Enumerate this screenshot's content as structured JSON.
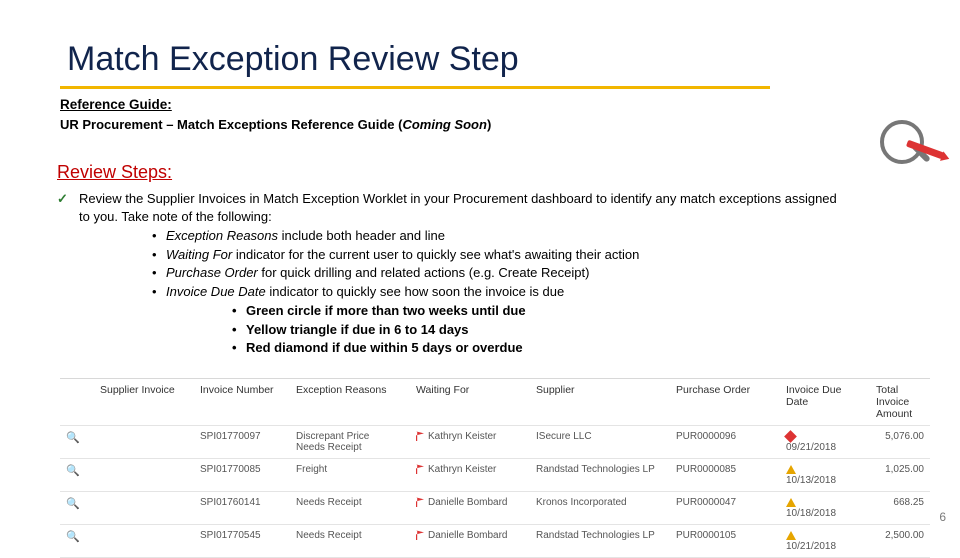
{
  "title": "Match Exception Review Step",
  "ref": {
    "label": "Reference Guide:",
    "body_a": "UR Procurement – Match Exceptions Reference Guide (",
    "coming": "Coming Soon",
    "body_b": ")"
  },
  "steps_label": "Review Steps:",
  "body": {
    "main": "Review the Supplier Invoices in Match Exception Worklet in your Procurement dashboard to identify any match exceptions assigned to you. Take note of the following:",
    "b1_lead": "Exception Reasons",
    "b1_rest": " include both header and line",
    "b2_lead": "Waiting For",
    "b2_rest": " indicator for the current user to quickly see what's awaiting their action",
    "b3_lead": "Purchase Order",
    "b3_rest": " for quick drilling and related actions (e.g. Create Receipt)",
    "b4_lead": "Invoice Due Date",
    "b4_rest": " indicator to quickly see how soon the invoice is due",
    "s1": "Green circle if more than two weeks until due",
    "s2": "Yellow triangle if due in 6 to 14 days",
    "s3": "Red diamond if due within 5 days or overdue"
  },
  "table": {
    "h": {
      "inv": "Supplier Invoice",
      "num": "Invoice Number",
      "exc": "Exception Reasons",
      "wait": "Waiting For",
      "sup": "Supplier",
      "po": "Purchase Order",
      "due": "Invoice Due Date",
      "amt": "Total Invoice Amount"
    },
    "r": [
      {
        "num": "SPI01770097",
        "exc1": "Discrepant Price",
        "exc2": "Needs Receipt",
        "wait": "Kathryn Keister",
        "sup": "ISecure LLC",
        "po": "PUR0000096",
        "due": "09/21/2018",
        "due_cls": "due-red",
        "amt": "5,076.00"
      },
      {
        "num": "SPI01770085",
        "exc1": "Freight",
        "exc2": "",
        "wait": "Kathryn Keister",
        "sup": "Randstad Technologies LP",
        "po": "PUR0000085",
        "due": "10/13/2018",
        "due_cls": "due-yel",
        "amt": "1,025.00"
      },
      {
        "num": "SPI01760141",
        "exc1": "Needs Receipt",
        "exc2": "",
        "wait": "Danielle Bombard",
        "sup": "Kronos Incorporated",
        "po": "PUR0000047",
        "due": "10/18/2018",
        "due_cls": "due-yel",
        "amt": "668.25"
      },
      {
        "num": "SPI01770545",
        "exc1": "Needs Receipt",
        "exc2": "",
        "wait": "Danielle Bombard",
        "sup": "Randstad Technologies LP",
        "po": "PUR0000105",
        "due": "10/21/2018",
        "due_cls": "due-yel",
        "amt": "2,500.00"
      }
    ]
  },
  "pagenum": "6"
}
